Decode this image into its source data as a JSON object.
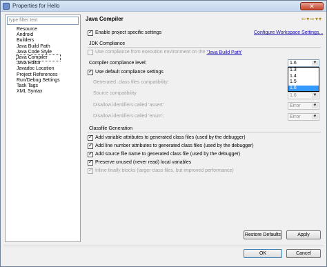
{
  "window": {
    "title": "Properties for Hello",
    "close_label": "✕"
  },
  "sidebar": {
    "filter_placeholder": "type filter text",
    "items": [
      {
        "label": "Resource"
      },
      {
        "label": "Android"
      },
      {
        "label": "Builders"
      },
      {
        "label": "Java Build Path"
      },
      {
        "label": "Java Code Style"
      },
      {
        "label": "Java Compiler"
      },
      {
        "label": "Java Editor"
      },
      {
        "label": "Javadoc Location"
      },
      {
        "label": "Project References"
      },
      {
        "label": "Run/Debug Settings"
      },
      {
        "label": "Task Tags"
      },
      {
        "label": "XML Syntax"
      }
    ],
    "selected": "Java Compiler"
  },
  "pane": {
    "title": "Java Compiler",
    "nav_arrows": "⇦▾⇨▾▾",
    "enable_specific": "Enable project specific settings",
    "configure_link": "Configure Workspace Settings...",
    "jdk_group": "JDK Compliance",
    "use_env_prefix": "Use compliance from execution environment on the ",
    "use_env_link": "'Java Build Path'",
    "compliance_label": "Compiler compliance level:",
    "compliance_value": "1.6",
    "compliance_options": [
      "1.3",
      "1.4",
      "1.5",
      "1.6"
    ],
    "use_default": "Use default compliance settings",
    "generated_label": "Generated .class files compatibility:",
    "generated_value": "1.6",
    "source_label": "Source compatibility:",
    "source_value": "1.6",
    "assert_label": "Disallow identifiers called 'assert':",
    "assert_value": "Error",
    "enum_label": "Disallow identifiers called 'enum':",
    "enum_value": "Error",
    "classfile_group": "Classfile Generation",
    "opt1": "Add variable attributes to generated class files (used by the debugger)",
    "opt2": "Add line number attributes to generated class files (used by the debugger)",
    "opt3": "Add source file name to generated class file (used by the debugger)",
    "opt4": "Preserve unused (never read) local variables",
    "opt5": "Inline finally blocks (larger class files, but improved performance)"
  },
  "buttons": {
    "restore": "Restore Defaults",
    "apply": "Apply",
    "ok": "OK",
    "cancel": "Cancel"
  }
}
